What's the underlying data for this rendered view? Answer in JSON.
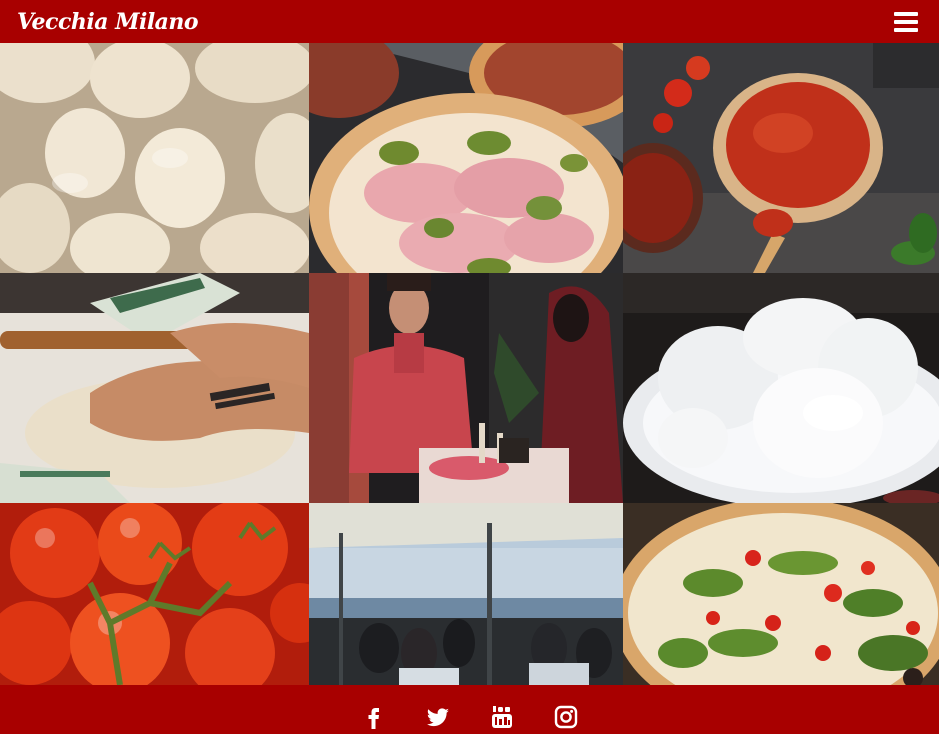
{
  "header": {
    "brand": "Vecchia Milano",
    "menu_icon": "hamburger-menu-icon"
  },
  "gallery": {
    "items": [
      {
        "subject": "dough-balls"
      },
      {
        "subject": "mortadella-pistachio-pizza"
      },
      {
        "subject": "tomato-sauce-on-dough"
      },
      {
        "subject": "hands-kneading-dough"
      },
      {
        "subject": "couple-dining"
      },
      {
        "subject": "mozzarella-on-plate"
      },
      {
        "subject": "vine-tomatoes"
      },
      {
        "subject": "terrace-with-umbrellas"
      },
      {
        "subject": "margherita-pesto-pizza"
      }
    ]
  },
  "footer": {
    "social": [
      {
        "icon": "facebook-icon"
      },
      {
        "icon": "twitter-icon"
      },
      {
        "icon": "youtube-icon"
      },
      {
        "icon": "instagram-icon"
      }
    ]
  },
  "colors": {
    "brand_red": "#a80000",
    "text_white": "#ffffff"
  }
}
